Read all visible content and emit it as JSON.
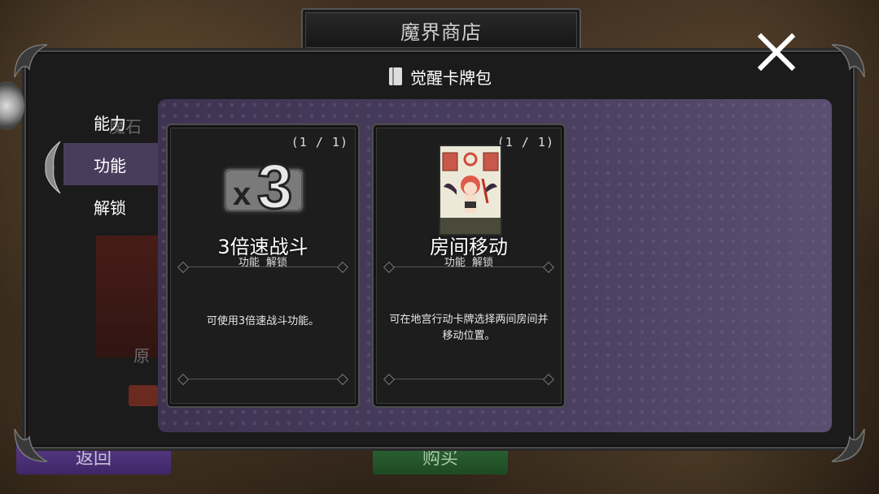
{
  "shop": {
    "title": "魔界商店"
  },
  "pack": {
    "title": "觉醒卡牌包"
  },
  "categories": [
    {
      "label": "能力"
    },
    {
      "label": "功能"
    },
    {
      "label": "解锁"
    }
  ],
  "selected_category": "功能",
  "background_hints": {
    "text1": "魔石",
    "text2": "原"
  },
  "cards": [
    {
      "count": "(1 / 1)",
      "icon": "x3-speed-icon",
      "name": "3倍速战斗",
      "tags": "功能 解锁",
      "description": "可使用3倍速战斗功能。"
    },
    {
      "count": "(1 / 1)",
      "icon": "room-move-card-art",
      "name": "房间移动",
      "tags": "功能 解锁",
      "description": "可在地宫行动卡牌选择两间房间并移动位置。"
    }
  ],
  "buttons": {
    "back": "返回",
    "buy": "购买"
  },
  "colors": {
    "panel_purple": "#4a3f5f",
    "active_category": "#4a3d5c",
    "back_button": "#5b3d8c",
    "buy_button": "#2f6a36"
  }
}
